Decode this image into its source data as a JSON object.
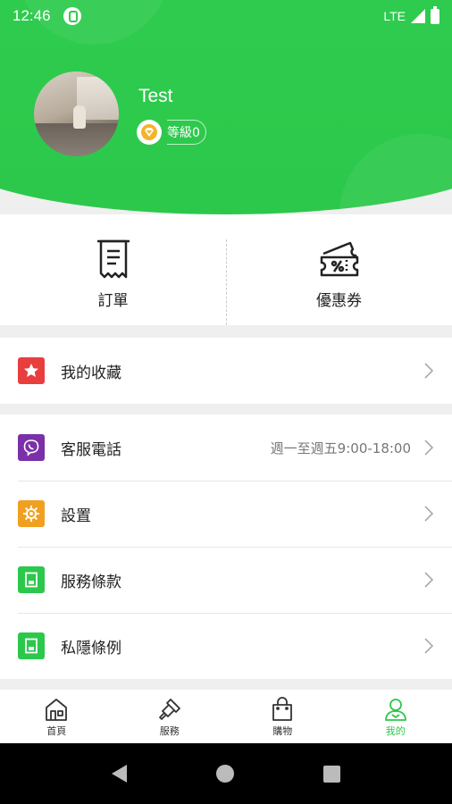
{
  "status_bar": {
    "time": "12:46",
    "network": "LTE"
  },
  "profile": {
    "username": "Test",
    "level_label": "等級0"
  },
  "quick_actions": [
    {
      "label": "訂單",
      "icon": "receipt-icon"
    },
    {
      "label": "優惠券",
      "icon": "coupon-icon"
    }
  ],
  "favorites": {
    "label": "我的收藏",
    "icon": "star-icon",
    "color": "#e83e3e"
  },
  "menu": [
    {
      "label": "客服電話",
      "sub": "週一至週五9:00-18:00",
      "icon": "phone-icon",
      "color": "#7b2fa8"
    },
    {
      "label": "設置",
      "sub": "",
      "icon": "gear-icon",
      "color": "#f0a020"
    },
    {
      "label": "服務條款",
      "sub": "",
      "icon": "document-icon",
      "color": "#2cc84b"
    },
    {
      "label": "私隱條例",
      "sub": "",
      "icon": "document-icon",
      "color": "#2cc84b"
    }
  ],
  "bottom_nav": [
    {
      "label": "首頁",
      "icon": "home-icon",
      "active": false
    },
    {
      "label": "服務",
      "icon": "brush-icon",
      "active": false
    },
    {
      "label": "購物",
      "icon": "shopping-bag-icon",
      "active": false
    },
    {
      "label": "我的",
      "icon": "user-icon",
      "active": true
    }
  ],
  "colors": {
    "brand": "#2cc84b"
  }
}
